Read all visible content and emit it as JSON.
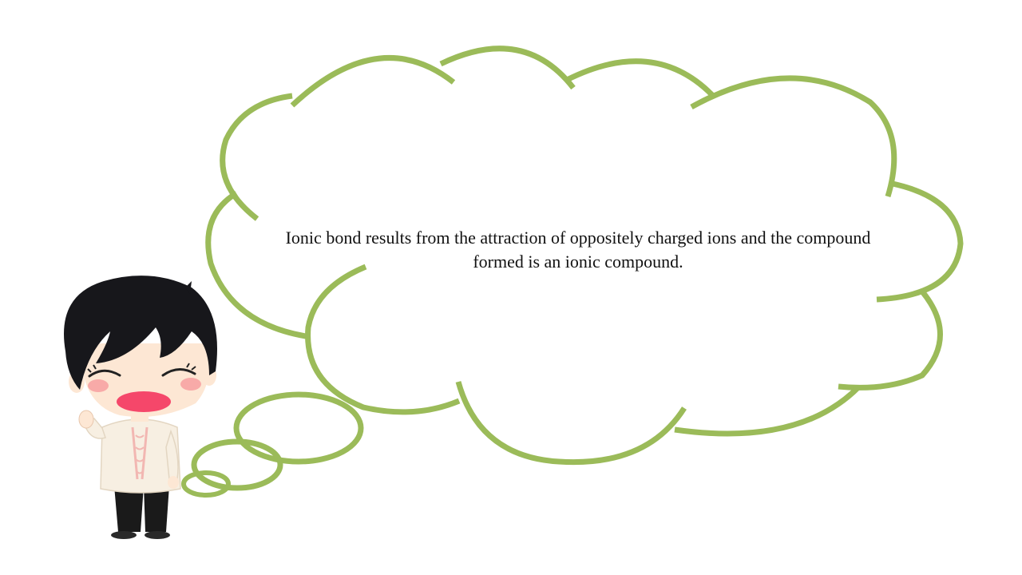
{
  "slide": {
    "text_lines": [
      "Ionic bond results from the attraction of oppositely charged ions and the compound",
      "formed is an ionic compound."
    ]
  },
  "colors": {
    "background": "#ffffff",
    "cloud_stroke": "#9bbb59",
    "hair": "#17171b",
    "skin": "#fde7d4",
    "blush": "#f7a3a3",
    "mouth": "#f5476a",
    "shirt": "#f7efe2",
    "embroidery": "#f2b7b2",
    "pants": "#1a1a1a"
  },
  "icons": [
    "thought-cloud-icon",
    "thinking-boy-icon"
  ]
}
